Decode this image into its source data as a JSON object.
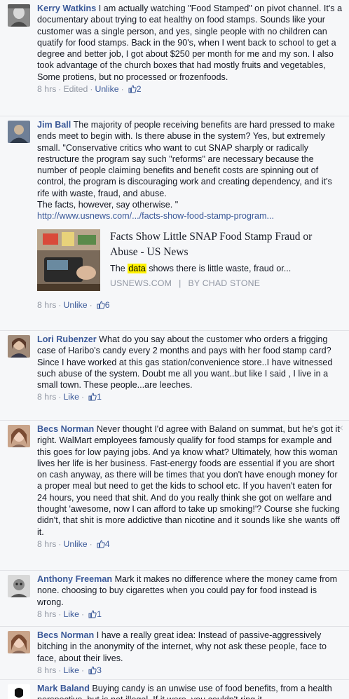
{
  "comments": [
    {
      "author": "Kerry Watkins",
      "text": "I am actually watching \"Food Stamped\" on pivot channel. It's a documentary about trying to eat healthy on food stamps. Sounds like your customer was a single person, and yes, single people with no children can quatify for food stamps. Back in the 90's, when I went back to school to get a degree and better job, I got about $250 per month for me and my son. I also took advantage of the church boxes that had mostly fruits and vegetables, Some protiens, but no processed or frozenfoods.",
      "time": "8 hrs",
      "edited": "Edited",
      "action": "Unlike",
      "likes": "2"
    },
    {
      "author": "Jim Ball",
      "text": "The majority of people receiving benefits are hard pressed to make ends meet to begin with. Is there abuse in the system? Yes, but extremely small. \"Conservative critics who want to cut SNAP sharply or radically restructure the program say such \"reforms\" are necessary because the number of people claiming benefits and benefit costs are spinning out of control, the program is discouraging work and creating dependency, and it's rife with waste, fraud, and abuse.\nThe facts, however, say otherwise. \"",
      "link": "http://www.usnews.com/.../facts-show-food-stamp-program...",
      "card": {
        "title": "Facts Show Little SNAP Food Stamp Fraud or Abuse - US News",
        "desc_before": "The ",
        "desc_highlight": "data",
        "desc_after": " shows there is little waste, fraud or...",
        "source": "USNEWS.COM",
        "separator": "|",
        "byline": "BY CHAD STONE"
      },
      "time": "8 hrs",
      "action": "Unlike",
      "likes": "6"
    },
    {
      "author": "Lori Rubenzer",
      "text": "What do you say about the customer who orders a frigging case of Haribo's candy every 2 months and pays with her food stamp card? Since I have worked at this gas station/convenience store..I have witnessed such abuse of the system. Doubt me all you want..but like I said , I live in a small town. These people...are leeches.",
      "time": "8 hrs",
      "action": "Like",
      "likes": "1"
    },
    {
      "author": "Becs Norman",
      "text": "Never thought I'd agree with Baland on summat, but he's got it right. WalMart employees famously qualify for food stamps for example and this goes for low paying jobs. And ya know what? Ultimately, how this woman lives her life is her business. Fast-energy foods are essential if you are short on cash anyway, as there will be times that you don't have enough money for a proper meal but need to get the kids to school etc. If you haven't eaten for 24 hours, you need that shit. And do you really think she got on welfare and thought 'awesome, now I can afford to take up smoking!'? Course she fucking didn't, that shit is more addictive than nicotine and it sounds like she wants off it.",
      "time": "8 hrs",
      "action": "Unlike",
      "likes": "4",
      "close": "×"
    },
    {
      "author": "Anthony Freeman",
      "text": "Mark it makes no difference where the money came from none. choosing to buy cigarettes when you could pay for food instead is wrong.",
      "time": "8 hrs",
      "action": "Like",
      "likes": "1"
    },
    {
      "author": "Becs Norman",
      "text": "I have a really great idea: Instead of passive-aggressively bitching in the anonymity of the internet, why not ask these people, face to face, about their lives.",
      "time": "8 hrs",
      "action": "Like",
      "likes": "3"
    },
    {
      "author": "Mark Baland",
      "text": "Buying candy is an unwise use of food benefits, from a health perspective, but is not illegal. If it were, you couldn't ring it"
    }
  ],
  "ui": {
    "dot": "·"
  }
}
